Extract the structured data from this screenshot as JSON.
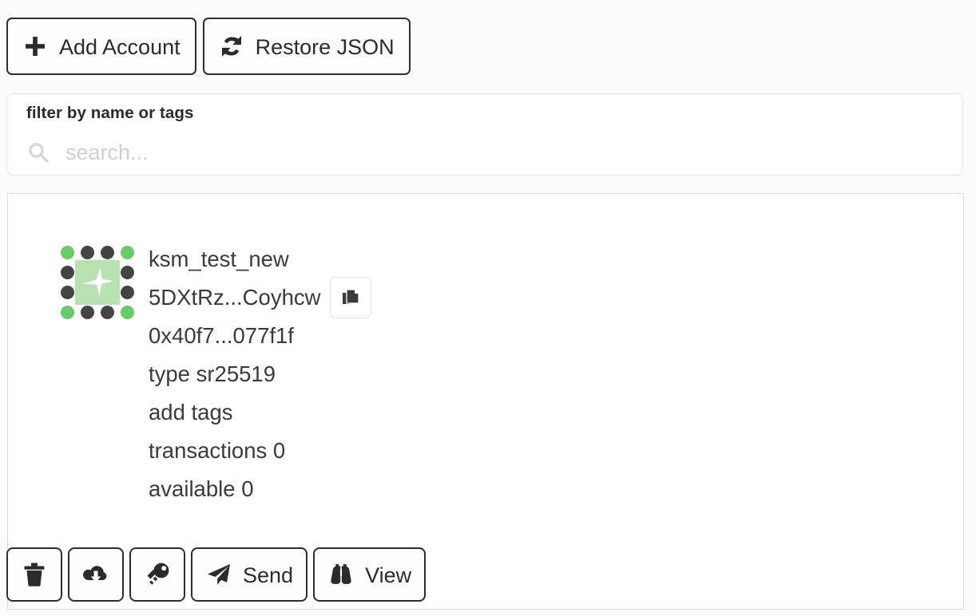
{
  "theme": {
    "page_background": "#fbfbfb",
    "card_background": "#ffffff",
    "border_dark": "#2e2e2e",
    "border_light": "#e0e0e0",
    "text": "#3b3b3b",
    "placeholder": "#cfcfcf",
    "identicon_green": "#66cc66",
    "identicon_dark": "#444444",
    "identicon_center_bg": "#b7e2b0"
  },
  "toolbar": {
    "add_account_label": "Add Account",
    "add_account_icon": "plus-icon",
    "restore_json_label": "Restore JSON",
    "restore_json_icon": "refresh-icon"
  },
  "filter": {
    "title": "filter by name or tags",
    "search_icon": "search-icon",
    "search_value": "",
    "search_placeholder": "search..."
  },
  "account": {
    "identicon": {
      "name": "account-identicon",
      "grid": [
        [
          "green",
          "dark",
          "dark",
          "green"
        ],
        [
          "dark",
          "dark",
          "dark",
          "dark"
        ],
        [
          "dark",
          "dark",
          "dark",
          "dark"
        ],
        [
          "green",
          "dark",
          "dark",
          "green"
        ]
      ],
      "center_glyph": "sparkle-icon"
    },
    "name": "ksm_test_new",
    "address": "5DXtRz...Coyhcw",
    "copy_icon": "copy-icon",
    "public_key": "0x40f7...077f1f",
    "type": "type sr25519",
    "tags": "add tags",
    "transactions": "transactions 0",
    "available": "available 0"
  },
  "actions": [
    {
      "name": "delete-button",
      "icon": "trash-icon",
      "label": ""
    },
    {
      "name": "backup-button",
      "icon": "cloud-download-icon",
      "label": ""
    },
    {
      "name": "change-password-button",
      "icon": "key-icon",
      "label": ""
    },
    {
      "name": "send-button",
      "icon": "paper-plane-icon",
      "label": "Send"
    },
    {
      "name": "view-button",
      "icon": "binoculars-icon",
      "label": "View"
    }
  ]
}
